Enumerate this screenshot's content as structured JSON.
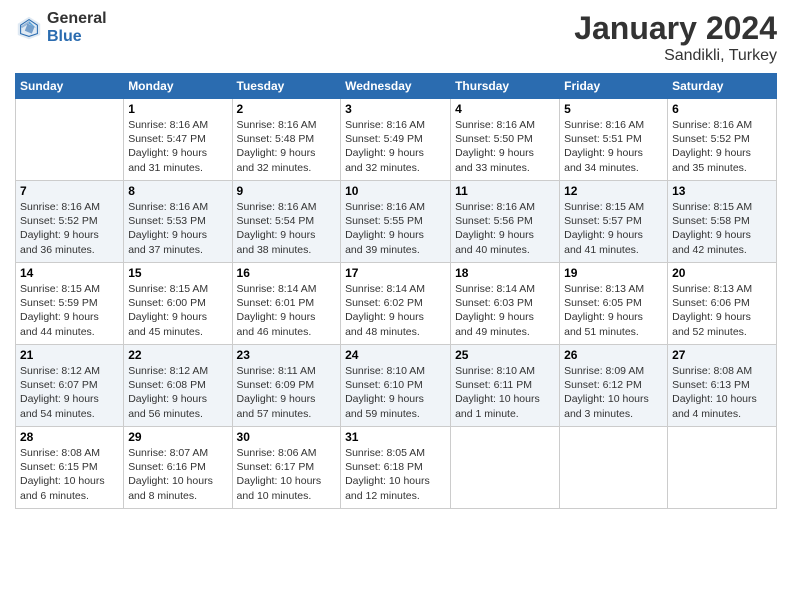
{
  "logo": {
    "general": "General",
    "blue": "Blue"
  },
  "title": "January 2024",
  "location": "Sandikli, Turkey",
  "days_header": [
    "Sunday",
    "Monday",
    "Tuesday",
    "Wednesday",
    "Thursday",
    "Friday",
    "Saturday"
  ],
  "weeks": [
    {
      "row_style": "normal-row",
      "days": [
        {
          "num": "",
          "info": ""
        },
        {
          "num": "1",
          "info": "Sunrise: 8:16 AM\nSunset: 5:47 PM\nDaylight: 9 hours\nand 31 minutes."
        },
        {
          "num": "2",
          "info": "Sunrise: 8:16 AM\nSunset: 5:48 PM\nDaylight: 9 hours\nand 32 minutes."
        },
        {
          "num": "3",
          "info": "Sunrise: 8:16 AM\nSunset: 5:49 PM\nDaylight: 9 hours\nand 32 minutes."
        },
        {
          "num": "4",
          "info": "Sunrise: 8:16 AM\nSunset: 5:50 PM\nDaylight: 9 hours\nand 33 minutes."
        },
        {
          "num": "5",
          "info": "Sunrise: 8:16 AM\nSunset: 5:51 PM\nDaylight: 9 hours\nand 34 minutes."
        },
        {
          "num": "6",
          "info": "Sunrise: 8:16 AM\nSunset: 5:52 PM\nDaylight: 9 hours\nand 35 minutes."
        }
      ]
    },
    {
      "row_style": "alt-row",
      "days": [
        {
          "num": "7",
          "info": "Sunrise: 8:16 AM\nSunset: 5:52 PM\nDaylight: 9 hours\nand 36 minutes."
        },
        {
          "num": "8",
          "info": "Sunrise: 8:16 AM\nSunset: 5:53 PM\nDaylight: 9 hours\nand 37 minutes."
        },
        {
          "num": "9",
          "info": "Sunrise: 8:16 AM\nSunset: 5:54 PM\nDaylight: 9 hours\nand 38 minutes."
        },
        {
          "num": "10",
          "info": "Sunrise: 8:16 AM\nSunset: 5:55 PM\nDaylight: 9 hours\nand 39 minutes."
        },
        {
          "num": "11",
          "info": "Sunrise: 8:16 AM\nSunset: 5:56 PM\nDaylight: 9 hours\nand 40 minutes."
        },
        {
          "num": "12",
          "info": "Sunrise: 8:15 AM\nSunset: 5:57 PM\nDaylight: 9 hours\nand 41 minutes."
        },
        {
          "num": "13",
          "info": "Sunrise: 8:15 AM\nSunset: 5:58 PM\nDaylight: 9 hours\nand 42 minutes."
        }
      ]
    },
    {
      "row_style": "normal-row",
      "days": [
        {
          "num": "14",
          "info": "Sunrise: 8:15 AM\nSunset: 5:59 PM\nDaylight: 9 hours\nand 44 minutes."
        },
        {
          "num": "15",
          "info": "Sunrise: 8:15 AM\nSunset: 6:00 PM\nDaylight: 9 hours\nand 45 minutes."
        },
        {
          "num": "16",
          "info": "Sunrise: 8:14 AM\nSunset: 6:01 PM\nDaylight: 9 hours\nand 46 minutes."
        },
        {
          "num": "17",
          "info": "Sunrise: 8:14 AM\nSunset: 6:02 PM\nDaylight: 9 hours\nand 48 minutes."
        },
        {
          "num": "18",
          "info": "Sunrise: 8:14 AM\nSunset: 6:03 PM\nDaylight: 9 hours\nand 49 minutes."
        },
        {
          "num": "19",
          "info": "Sunrise: 8:13 AM\nSunset: 6:05 PM\nDaylight: 9 hours\nand 51 minutes."
        },
        {
          "num": "20",
          "info": "Sunrise: 8:13 AM\nSunset: 6:06 PM\nDaylight: 9 hours\nand 52 minutes."
        }
      ]
    },
    {
      "row_style": "alt-row",
      "days": [
        {
          "num": "21",
          "info": "Sunrise: 8:12 AM\nSunset: 6:07 PM\nDaylight: 9 hours\nand 54 minutes."
        },
        {
          "num": "22",
          "info": "Sunrise: 8:12 AM\nSunset: 6:08 PM\nDaylight: 9 hours\nand 56 minutes."
        },
        {
          "num": "23",
          "info": "Sunrise: 8:11 AM\nSunset: 6:09 PM\nDaylight: 9 hours\nand 57 minutes."
        },
        {
          "num": "24",
          "info": "Sunrise: 8:10 AM\nSunset: 6:10 PM\nDaylight: 9 hours\nand 59 minutes."
        },
        {
          "num": "25",
          "info": "Sunrise: 8:10 AM\nSunset: 6:11 PM\nDaylight: 10 hours\nand 1 minute."
        },
        {
          "num": "26",
          "info": "Sunrise: 8:09 AM\nSunset: 6:12 PM\nDaylight: 10 hours\nand 3 minutes."
        },
        {
          "num": "27",
          "info": "Sunrise: 8:08 AM\nSunset: 6:13 PM\nDaylight: 10 hours\nand 4 minutes."
        }
      ]
    },
    {
      "row_style": "normal-row",
      "days": [
        {
          "num": "28",
          "info": "Sunrise: 8:08 AM\nSunset: 6:15 PM\nDaylight: 10 hours\nand 6 minutes."
        },
        {
          "num": "29",
          "info": "Sunrise: 8:07 AM\nSunset: 6:16 PM\nDaylight: 10 hours\nand 8 minutes."
        },
        {
          "num": "30",
          "info": "Sunrise: 8:06 AM\nSunset: 6:17 PM\nDaylight: 10 hours\nand 10 minutes."
        },
        {
          "num": "31",
          "info": "Sunrise: 8:05 AM\nSunset: 6:18 PM\nDaylight: 10 hours\nand 12 minutes."
        },
        {
          "num": "",
          "info": ""
        },
        {
          "num": "",
          "info": ""
        },
        {
          "num": "",
          "info": ""
        }
      ]
    }
  ]
}
